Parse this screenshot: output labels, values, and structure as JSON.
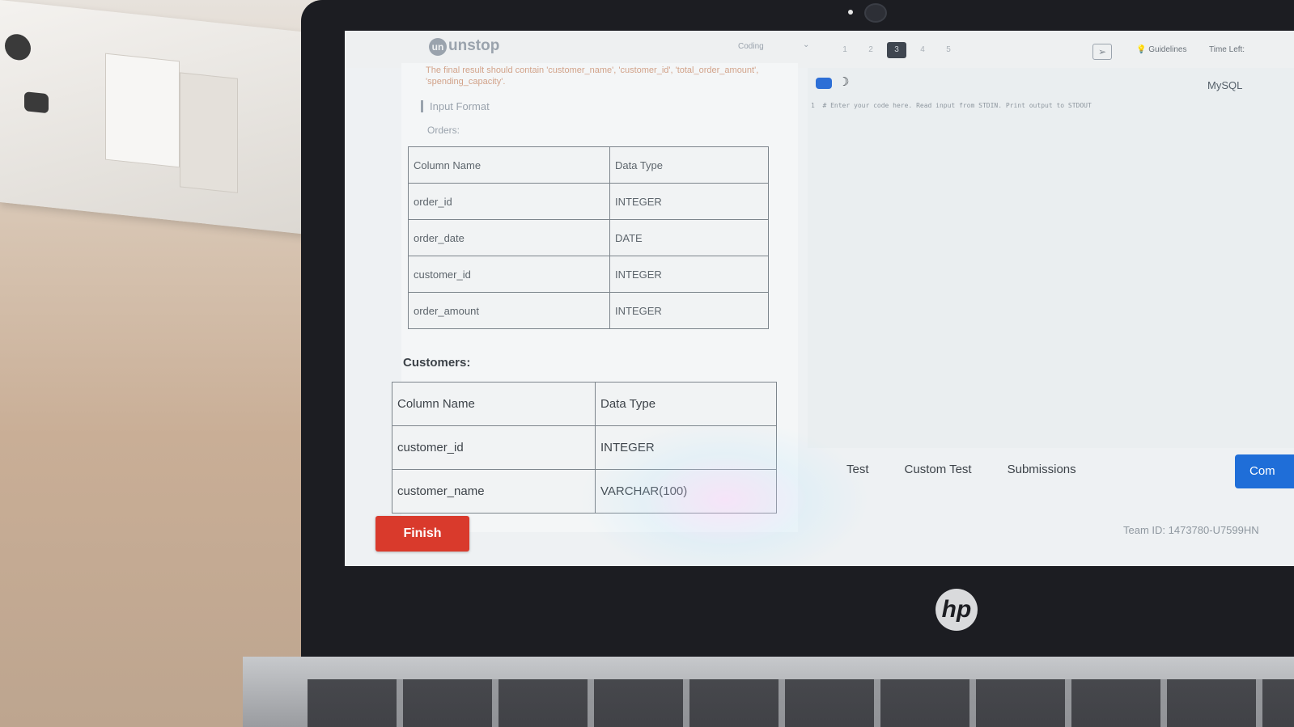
{
  "app": {
    "logo_text": "unstop",
    "section_select": "Coding",
    "question_numbers": [
      "1",
      "2",
      "3",
      "4",
      "5"
    ],
    "active_question": "3",
    "guidelines_label": "Guidelines",
    "time_left_label": "Time Left:"
  },
  "problem": {
    "description": "The final result should contain 'customer_name', 'customer_id', 'total_order_amount', 'spending_capacity'.",
    "input_format_label": "Input Format",
    "orders_label": "Orders:",
    "orders_table": {
      "headers": [
        "Column Name",
        "Data Type"
      ],
      "rows": [
        [
          "order_id",
          "INTEGER"
        ],
        [
          "order_date",
          "DATE"
        ],
        [
          "customer_id",
          "INTEGER"
        ],
        [
          "order_amount",
          "INTEGER"
        ]
      ]
    },
    "customers_label": "Customers:",
    "customers_table": {
      "headers": [
        "Column Name",
        "Data Type"
      ],
      "rows": [
        [
          "customer_id",
          "INTEGER"
        ],
        [
          "customer_name",
          "VARCHAR(100)"
        ]
      ]
    }
  },
  "editor": {
    "language": "MySQL",
    "line_number": "1",
    "placeholder_line": "# Enter your code here. Read input from STDIN. Print output to STDOUT"
  },
  "tabs": [
    "Test",
    "Custom Test",
    "Submissions"
  ],
  "compile_button": "Com",
  "finish_button": "Finish",
  "team_id": "Team ID: 1473780-U7599HN",
  "colors": {
    "finish_red": "#d93a2c",
    "compile_blue": "#1f6ed8",
    "toggle_blue": "#2d6fd6"
  },
  "device_logo": "hp"
}
